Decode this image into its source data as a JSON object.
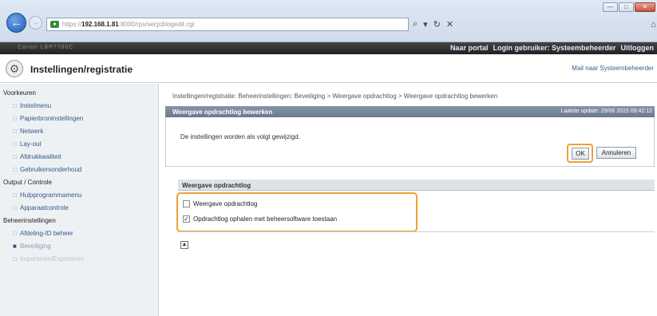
{
  "browser": {
    "url_prefix": "https://",
    "url_host": "192.168.1.81",
    "url_path": ":8000/rps/secjoblogedit.cgi",
    "addr_tools": [
      "⌕",
      "▾",
      "↻",
      "✕",
      "⌂",
      "☆",
      "⚙"
    ],
    "win_min": "—",
    "win_max": "□",
    "win_close": "✕"
  },
  "portal": {
    "device_name": "Canon LBP7780C",
    "link_portal": "Naar portal",
    "login_user": "Login gebruiker: Systeembeheerder",
    "logout": "Uitloggen"
  },
  "header": {
    "title": "Instellingen/registratie",
    "mail_admin": "Mail naar Systeembeheerder"
  },
  "sidebar": {
    "sections": [
      {
        "label": "Voorkeuren",
        "items": [
          "Instelmenu",
          "Papierbroninstellingen",
          "Netwerk",
          "Lay-out",
          "Afdrukkwaliteit",
          "Gebruikersonderhoud"
        ]
      },
      {
        "label": "Output / Controle",
        "items": [
          "Hulpprogrammamenu",
          "Apparaatcontrole"
        ]
      },
      {
        "label": "Beheerinstellingen",
        "items": [
          "Afdeling-ID beheer",
          "Beveiliging",
          "Importeren/Exporteren"
        ]
      }
    ]
  },
  "breadcrumb": "Instellingen/registratie: Beheerinstellingen: Beveiliging > Weergave opdrachtlog > Weergave opdrachtlog bewerken",
  "panel": {
    "title": "Weergave opdrachtlog bewerken",
    "last_update": "Laatste update: 29/06 2015 09:42:12",
    "message": "De instellingen worden als volgt gewijzigd.",
    "ok_label": "OK",
    "cancel_label": "Annuleren"
  },
  "section": {
    "title": "Weergave opdrachtlog",
    "options": [
      {
        "label": "Weergave opdrachtlog",
        "checked": false
      },
      {
        "label": "Opdrachtlog ophalen met beheersoftware toestaan",
        "checked": true
      }
    ]
  },
  "page_top_icon": "▲",
  "colors": {
    "highlight": "#f0a030",
    "panel_bar": "#7a889c",
    "link": "#34598a"
  }
}
